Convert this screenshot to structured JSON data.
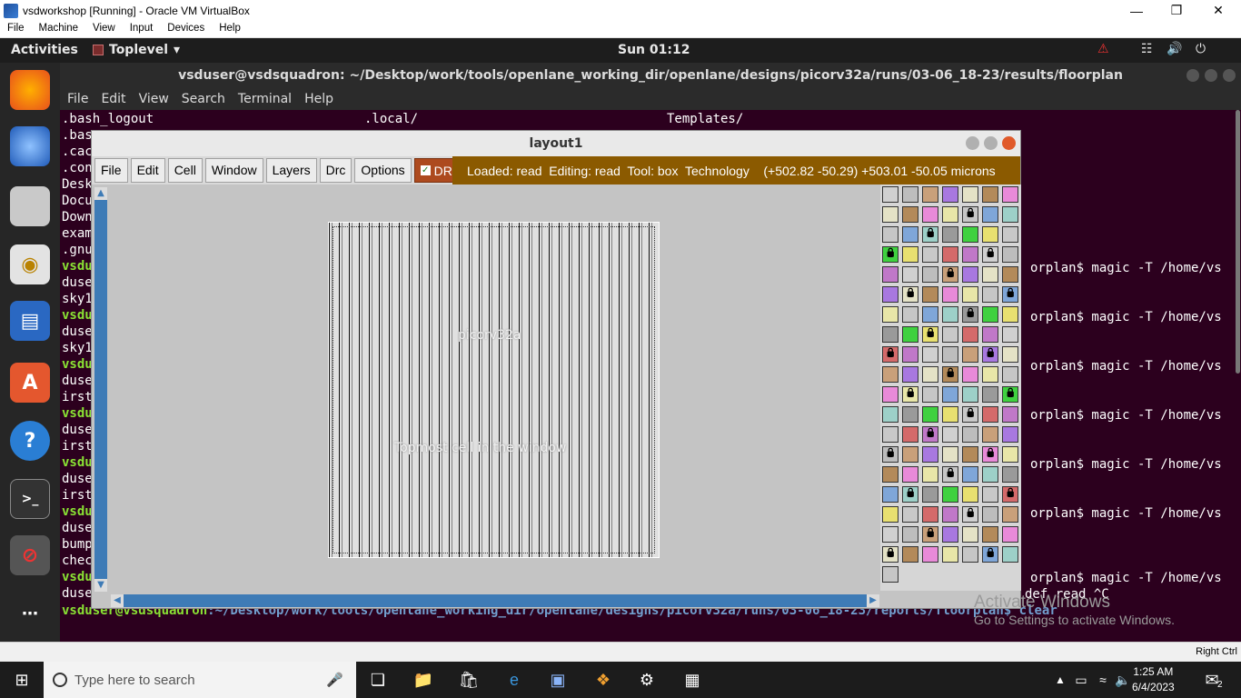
{
  "host": {
    "title": "vsdworkshop [Running] - Oracle VM VirtualBox",
    "menu": [
      "File",
      "Machine",
      "View",
      "Input",
      "Devices",
      "Help"
    ],
    "status_right": "Right Ctrl"
  },
  "gnome": {
    "activities": "Activities",
    "app": "Toplevel",
    "clock": "Sun 01:12"
  },
  "terminal": {
    "title": "vsduser@vsdsquadron: ~/Desktop/work/tools/openlane_working_dir/openlane/designs/picorv32a/runs/03-06_18-23/results/floorplan",
    "menu": [
      "File",
      "Edit",
      "View",
      "Search",
      "Terminal",
      "Help"
    ],
    "row0": [
      ".bash_logout",
      ".local/",
      "Templates/"
    ],
    "left_fragments": [
      ".bas",
      ".cac",
      ".con",
      "Desk",
      "Docu",
      "Down",
      "exam",
      ".gnu",
      "vsdu",
      "duse",
      "sky1",
      "vsdu",
      "duse",
      "sky1",
      "vsdu",
      "duse",
      "irst",
      "vsdu",
      "duse",
      "irst",
      "vsdu",
      "duse",
      "irst",
      "vsdu",
      "duse",
      "bump",
      "chec",
      "vsdu",
      "duse"
    ],
    "right_cmd": "orplan$ magic -T /home/vs",
    "def_read": "def read ^C",
    "bottom_prompt_user": "vsduser@vsdsquadron",
    "bottom_prompt_path": ":~/Desktop/work/tools/openlane_working_dir/openlane/designs/picorv32a/runs/03-06_18-23/reports/floorplan$ clear"
  },
  "magic": {
    "title": "layout1",
    "menu": [
      "File",
      "Edit",
      "Cell",
      "Window",
      "Layers",
      "Drc",
      "Options"
    ],
    "drc_label": "DRC",
    "status": "Loaded: read  Editing: read  Tool: box  Technology    (+502.82 -50.29) +503.01 -50.05 microns",
    "cell_name": "picorv32a",
    "cell_note": "Topmost cell in the window"
  },
  "watermark": {
    "line1": "Activate Windows",
    "line2": "Go to Settings to activate Windows."
  },
  "taskbar": {
    "search_placeholder": "Type here to search",
    "time": "1:25 AM",
    "date": "6/4/2023",
    "notif_count": "2"
  }
}
